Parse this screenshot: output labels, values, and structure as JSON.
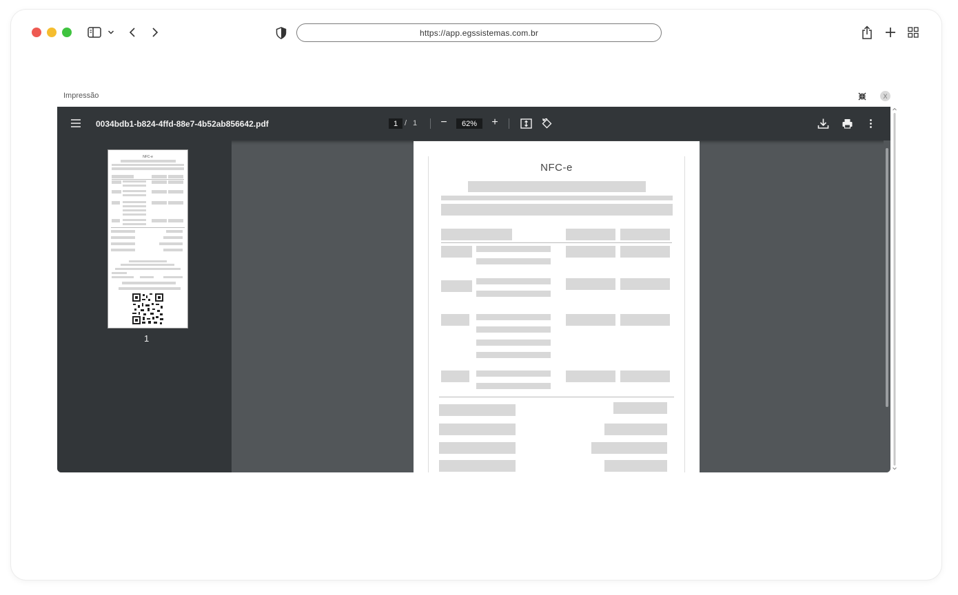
{
  "browser": {
    "url": "https://app.egssistemas.com.br",
    "icons": [
      "sidebar-icon",
      "chevron-down-icon",
      "back-arrow-icon",
      "forward-arrow-icon",
      "shield-icon",
      "share-icon",
      "new-tab-icon",
      "tab-overview-icon"
    ]
  },
  "modal": {
    "title": "Impressão",
    "close_label": "X"
  },
  "pdf_viewer": {
    "file_name": "0034bdb1-b824-4ffd-88e7-4b52ab856642.pdf",
    "current_page": "1",
    "page_separator": "/",
    "total_pages": "1",
    "zoom": "62%",
    "zoom_out_label": "−",
    "zoom_in_label": "+",
    "thumbnail_page_number": "1"
  },
  "document": {
    "title": "NFC-e"
  }
}
